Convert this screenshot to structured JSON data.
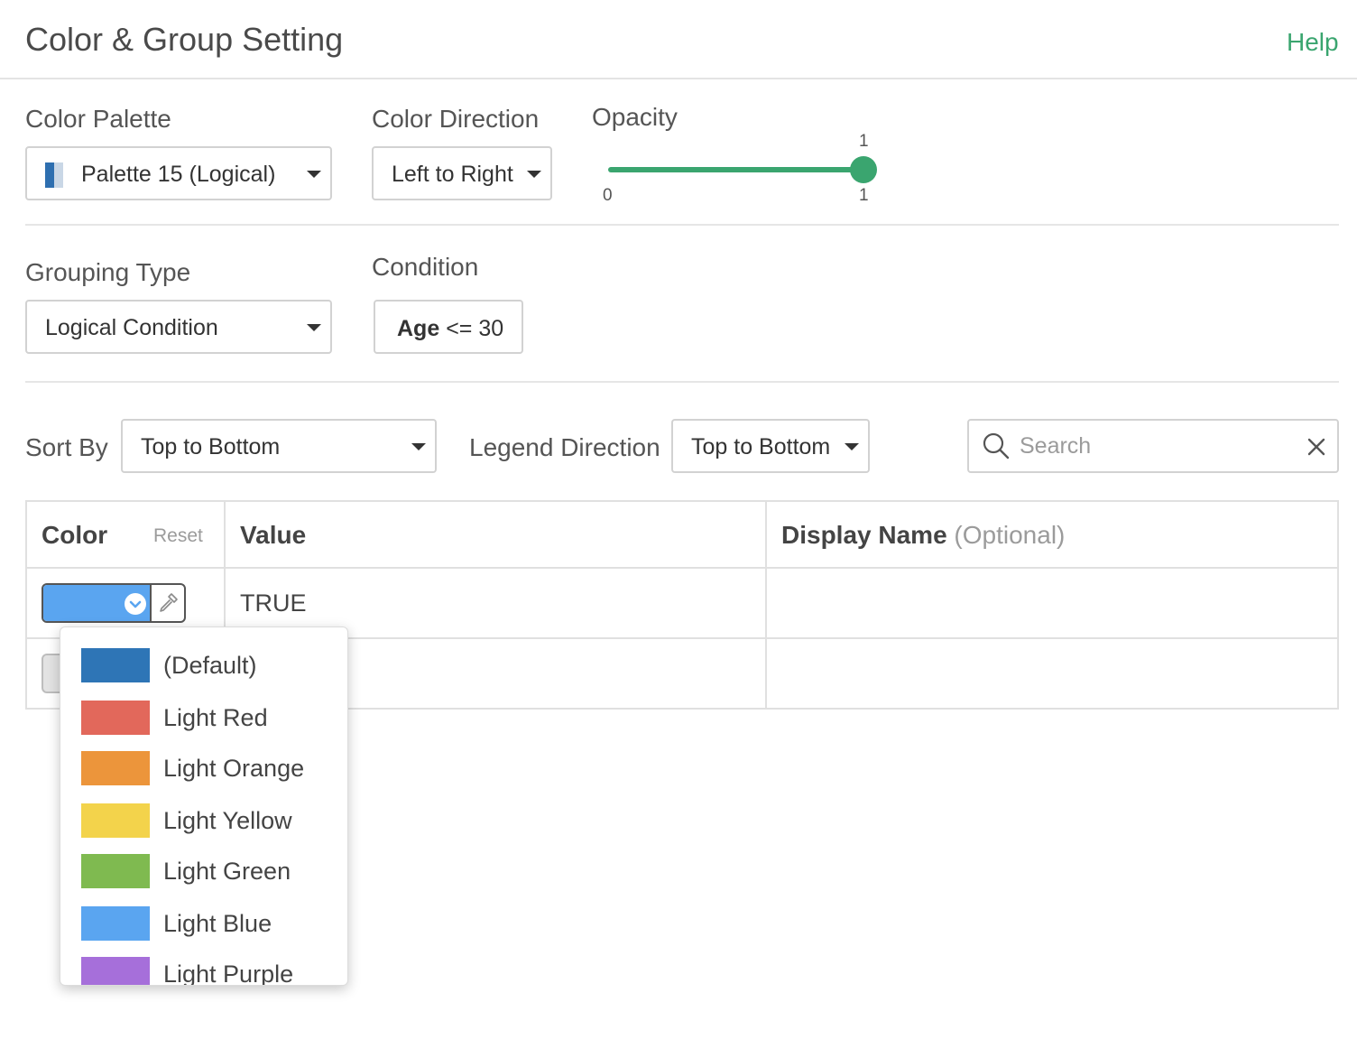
{
  "header": {
    "title": "Color & Group Setting",
    "help": "Help"
  },
  "palette": {
    "label": "Color Palette",
    "value": "Palette 15 (Logical)"
  },
  "direction": {
    "label": "Color Direction",
    "value": "Left to Right"
  },
  "opacity": {
    "label": "Opacity",
    "value": "1",
    "min": "0",
    "max": "1",
    "level": 1
  },
  "grouping": {
    "label": "Grouping Type",
    "value": "Logical Condition"
  },
  "condition": {
    "label": "Condition",
    "field": "Age",
    "expr": "<= 30"
  },
  "sort": {
    "label": "Sort By",
    "value": "Top to Bottom"
  },
  "legend": {
    "label": "Legend Direction",
    "value": "Top to Bottom"
  },
  "search": {
    "placeholder": "Search"
  },
  "table": {
    "color_header": "Color",
    "reset": "Reset",
    "value_header": "Value",
    "display_header": "Display Name",
    "display_optional": "(Optional)",
    "rows": [
      {
        "value": "TRUE",
        "color": "#5aa5f0"
      },
      {
        "value": "",
        "color": "#e3e3e3"
      }
    ]
  },
  "color_menu": {
    "items": [
      {
        "label": "(Default)",
        "color": "#2e75b6"
      },
      {
        "label": "Light Red",
        "color": "#e2685b"
      },
      {
        "label": "Light Orange",
        "color": "#ec953b"
      },
      {
        "label": "Light Yellow",
        "color": "#f3d34b"
      },
      {
        "label": "Light Green",
        "color": "#7fba50"
      },
      {
        "label": "Light Blue",
        "color": "#5aa5f0"
      },
      {
        "label": "Light Purple",
        "color": "#a66fda"
      }
    ]
  },
  "colors": {
    "accent": "#3aa56f"
  }
}
